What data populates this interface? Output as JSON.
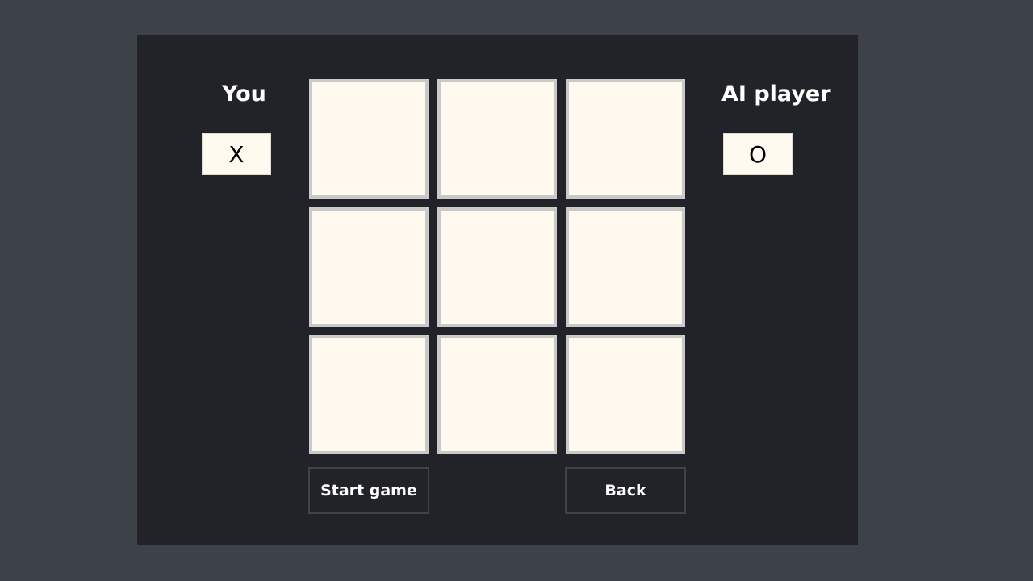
{
  "players": {
    "human": {
      "label": "You",
      "mark": "X"
    },
    "ai": {
      "label": "AI player",
      "mark": "O"
    }
  },
  "board": {
    "cells": [
      "",
      "",
      "",
      "",
      "",
      "",
      "",
      "",
      ""
    ]
  },
  "buttons": {
    "start_label": "Start game",
    "back_label": "Back"
  },
  "colors": {
    "page_background": "#3d4249",
    "panel_background": "#212328",
    "cell_fill": "#fff9ef",
    "cell_border": "#c9c9c9"
  }
}
